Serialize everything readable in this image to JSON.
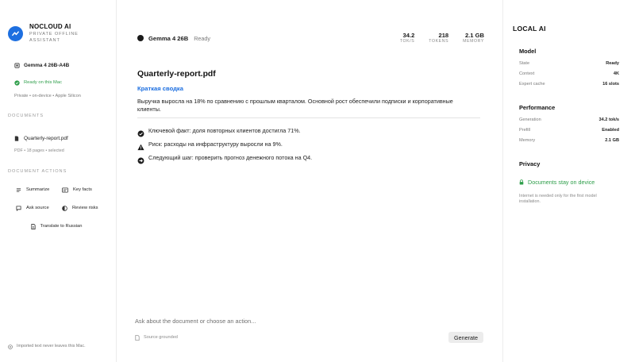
{
  "brand": {
    "name": "NOCLOUD AI",
    "subtitle": "PRIVATE OFFLINE ASSISTANT",
    "accent": "#1d6fe0"
  },
  "sidebar": {
    "model": "Gemma 4 26B-A4B",
    "model_status": "Ready on this Mac",
    "model_detail": "Private • on-device • Apple Silicon",
    "documents_label": "DOCUMENTS",
    "document": {
      "name": "Quarterly-report.pdf",
      "meta": "PDF • 18 pages • selected"
    },
    "actions_label": "DOCUMENT ACTIONS",
    "actions": [
      {
        "label": "Summarize",
        "icon": "lines-icon"
      },
      {
        "label": "Key facts",
        "icon": "card-icon"
      },
      {
        "label": "Ask source",
        "icon": "chat-icon"
      },
      {
        "label": "Review risks",
        "icon": "half-circle-icon"
      },
      {
        "label": "Translate to Russian",
        "icon": "document-icon"
      }
    ],
    "footer": "Imported text never leaves this Mac."
  },
  "topbar": {
    "model": "Gemma 4 26B",
    "status": "Ready",
    "stats": [
      {
        "value": "34.2",
        "label": "TOK/S"
      },
      {
        "value": "218",
        "label": "TOKENS"
      },
      {
        "value": "2.1 GB",
        "label": "MEMORY"
      }
    ]
  },
  "document_view": {
    "title": "Quarterly-report.pdf",
    "summary_heading": "Краткая сводка",
    "summary_text": "Выручка выросла на 18% по сравнению с прошлым кварталом. Основной рост обеспечили подписки и корпоративные клиенты.",
    "bullets": [
      {
        "icon": "check-circle-icon",
        "text": "Ключевой факт: доля повторных клиентов достигла 71%."
      },
      {
        "icon": "warning-icon",
        "text": "Риск: расходы на инфраструктуру выросли на 9%."
      },
      {
        "icon": "arrow-circle-icon",
        "text": "Следующий шаг: проверить прогноз денежного потока на Q4."
      }
    ]
  },
  "composer": {
    "placeholder": "Ask about the document or choose an action...",
    "grounded_label": "Source grounded",
    "generate_label": "Generate"
  },
  "right_panel": {
    "title": "LOCAL AI",
    "model_section": "Model",
    "model_rows": [
      {
        "key": "State",
        "value": "Ready"
      },
      {
        "key": "Context",
        "value": "4K"
      },
      {
        "key": "Expert cache",
        "value": "16 slots"
      }
    ],
    "performance_section": "Performance",
    "performance_rows": [
      {
        "key": "Generation",
        "value": "34.2 tok/s"
      },
      {
        "key": "Prefill",
        "value": "Enabled"
      },
      {
        "key": "Memory",
        "value": "2.1 GB"
      }
    ],
    "privacy_section": "Privacy",
    "privacy_status": "Documents stay on device",
    "privacy_note": "Internet is needed only for the first model installation.",
    "success_color": "#2e9e4a"
  }
}
